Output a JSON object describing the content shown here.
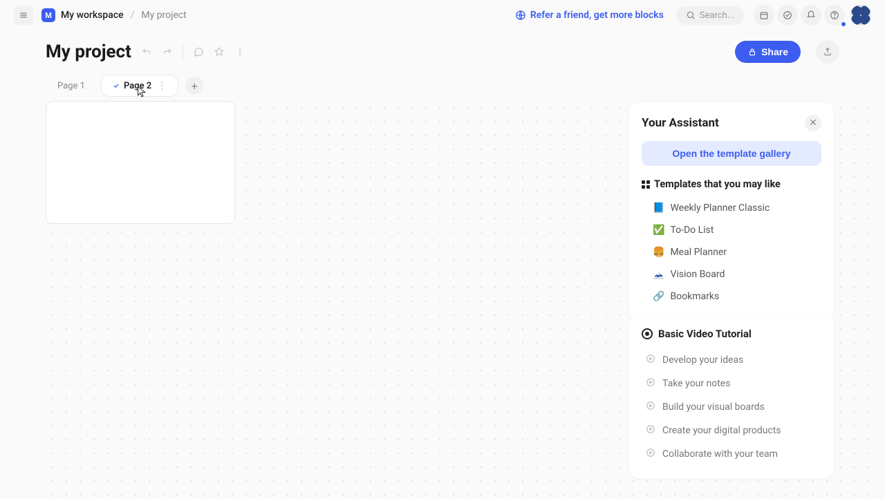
{
  "topbar": {
    "workspace_initial": "M",
    "workspace": "My workspace",
    "project": "My project",
    "refer": "Refer a friend, get more blocks",
    "search_placeholder": "Search..."
  },
  "title": {
    "heading": "My project",
    "share": "Share"
  },
  "tabs": [
    {
      "label": "Page 1",
      "active": false
    },
    {
      "label": "Page 2",
      "active": true
    }
  ],
  "assistant": {
    "title": "Your Assistant",
    "gallery_btn": "Open the template gallery",
    "templates_heading": "Templates that you may like",
    "templates": [
      {
        "emoji": "📘",
        "label": "Weekly Planner Classic"
      },
      {
        "emoji": "✅",
        "label": "To-Do List"
      },
      {
        "emoji": "🍔",
        "label": "Meal Planner"
      },
      {
        "emoji": "🗻",
        "label": "Vision Board"
      },
      {
        "emoji": "🔗",
        "label": "Bookmarks"
      }
    ]
  },
  "videos": {
    "title": "Basic Video Tutorial",
    "items": [
      "Develop your ideas",
      "Take your notes",
      "Build your visual boards",
      "Create your digital products",
      "Collaborate with your team"
    ]
  },
  "colors": {
    "accent": "#3c5df0"
  }
}
